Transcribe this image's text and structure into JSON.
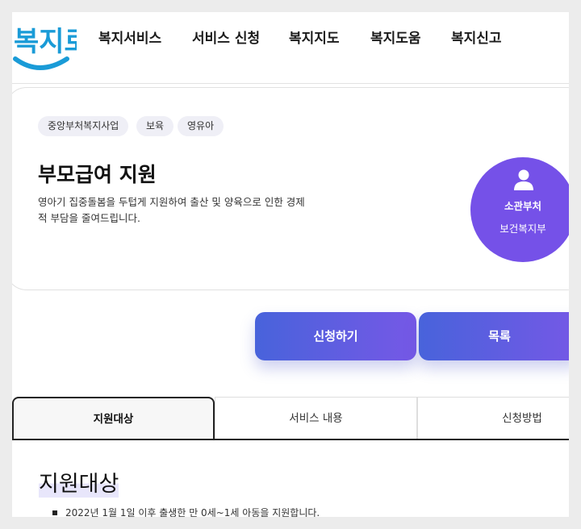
{
  "header": {
    "logo_text": "복지로",
    "nav": [
      {
        "label": "복지서비스"
      },
      {
        "label": "서비스 신청"
      },
      {
        "label": "복지지도"
      },
      {
        "label": "복지도움"
      },
      {
        "label": "복지신고"
      }
    ]
  },
  "service": {
    "tags": [
      "중앙부처복지사업",
      "보육",
      "영유아"
    ],
    "title": "부모급여 지원",
    "description": "영아기 집중돌봄을 두텁게 지원하여 출산 및 양육으로 인한 경제적 부담을 줄여드립니다.",
    "department": {
      "label": "소관부처",
      "value": "보건복지부",
      "icon": "person-icon"
    }
  },
  "actions": {
    "apply": "신청하기",
    "list": "목록"
  },
  "tabs": [
    {
      "label": "지원대상",
      "active": true
    },
    {
      "label": "서비스 내용",
      "active": false
    },
    {
      "label": "신청방법",
      "active": false
    }
  ],
  "content": {
    "section_title": "지원대상",
    "bullets": [
      "2022년 1월 1일 이후 출생한 만 0세~1세 아동을 지원합니다."
    ]
  },
  "colors": {
    "accent": "#7551e8",
    "button_start": "#4863db",
    "button_end": "#7658e6",
    "logo_blue": "#1a9bd7"
  }
}
